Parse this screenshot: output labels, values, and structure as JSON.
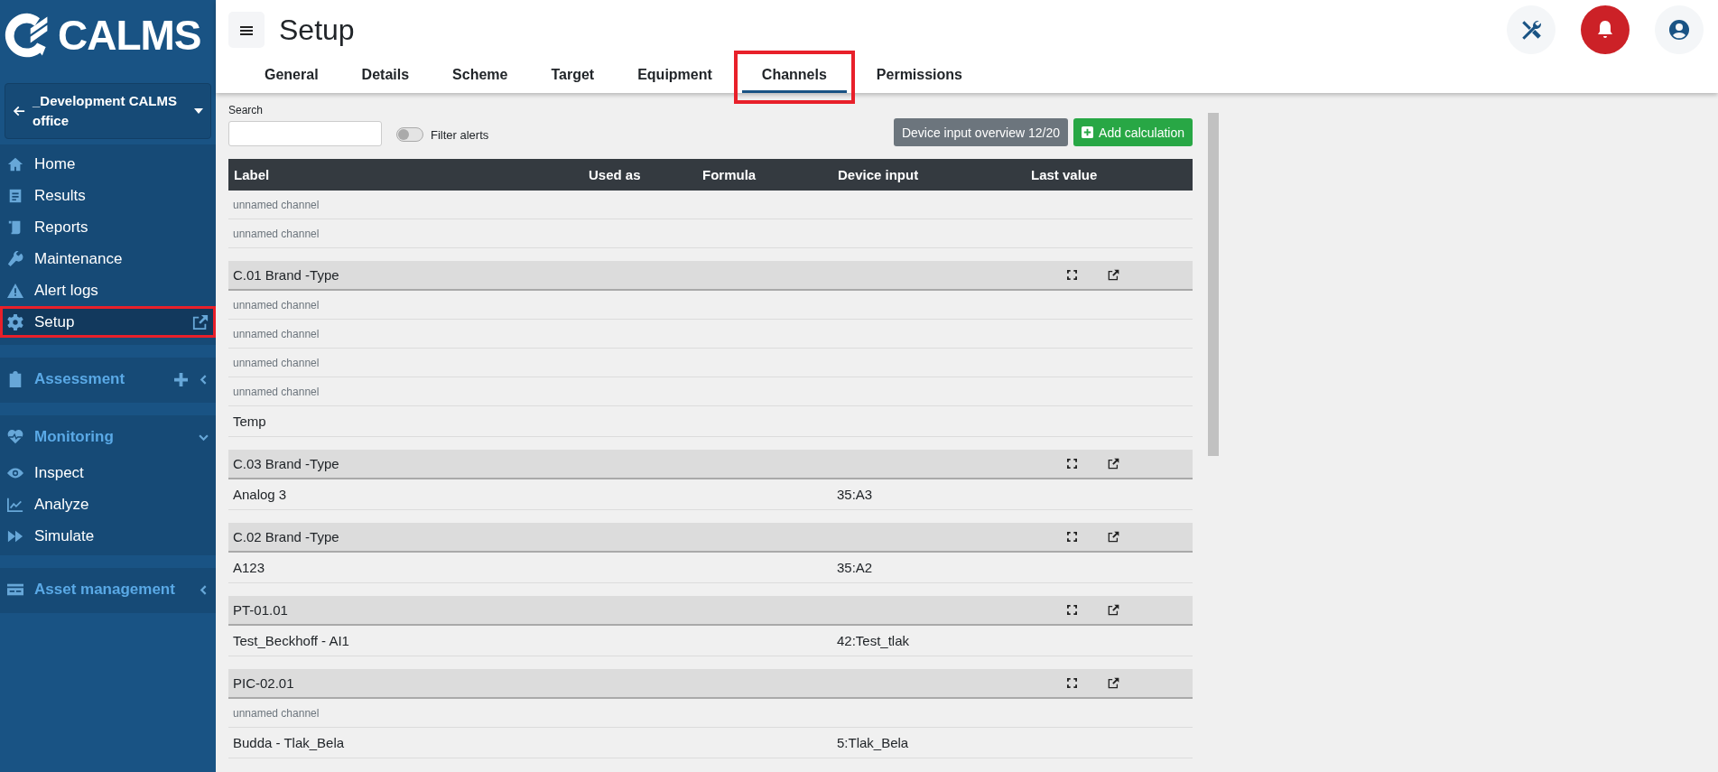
{
  "logo": {
    "text": "CALMS"
  },
  "project": {
    "name": "_Development CALMS office"
  },
  "sidebar": {
    "items": [
      {
        "label": "Home",
        "selected": false,
        "highlighted": false
      },
      {
        "label": "Results",
        "selected": false,
        "highlighted": false
      },
      {
        "label": "Reports",
        "selected": false,
        "highlighted": false
      },
      {
        "label": "Maintenance",
        "selected": false,
        "highlighted": false
      },
      {
        "label": "Alert logs",
        "selected": false,
        "highlighted": false
      },
      {
        "label": "Setup",
        "selected": true,
        "highlighted": true,
        "external": true
      }
    ],
    "sections": [
      {
        "label": "Assessment",
        "expanded": false,
        "addable": true
      },
      {
        "label": "Monitoring",
        "expanded": true,
        "items": [
          {
            "label": "Inspect"
          },
          {
            "label": "Analyze"
          },
          {
            "label": "Simulate"
          }
        ]
      },
      {
        "label": "Asset management",
        "expanded": false
      }
    ]
  },
  "header": {
    "title": "Setup"
  },
  "tabs": [
    {
      "label": "General",
      "selected": false,
      "highlighted": false
    },
    {
      "label": "Details",
      "selected": false,
      "highlighted": false
    },
    {
      "label": "Scheme",
      "selected": false,
      "highlighted": false
    },
    {
      "label": "Target",
      "selected": false,
      "highlighted": false
    },
    {
      "label": "Equipment",
      "selected": false,
      "highlighted": false
    },
    {
      "label": "Channels",
      "selected": true,
      "highlighted": true
    },
    {
      "label": "Permissions",
      "selected": false,
      "highlighted": false
    }
  ],
  "toolbar": {
    "search_label": "Search",
    "filter_alerts": {
      "label": "Filter alerts",
      "on": false
    },
    "overview_button": "Device input overview 12/20",
    "add_button": "Add calculation"
  },
  "table": {
    "columns": [
      "Label",
      "Used as",
      "Formula",
      "Device input",
      "Last value"
    ],
    "groups": [
      {
        "rows": [
          {
            "kind": "unnamed",
            "label": "unnamed channel"
          },
          {
            "kind": "unnamed",
            "label": "unnamed channel"
          }
        ]
      },
      {
        "title": "C.01 Brand -Type",
        "rows": [
          {
            "kind": "unnamed",
            "label": "unnamed channel"
          },
          {
            "kind": "unnamed",
            "label": "unnamed channel"
          },
          {
            "kind": "unnamed",
            "label": "unnamed channel"
          },
          {
            "kind": "unnamed",
            "label": "unnamed channel"
          },
          {
            "kind": "named",
            "label": "Temp"
          }
        ]
      },
      {
        "title": "C.03 Brand -Type",
        "rows": [
          {
            "kind": "named",
            "label": "Analog 3",
            "device_input": "35:A3"
          }
        ]
      },
      {
        "title": "C.02 Brand -Type",
        "rows": [
          {
            "kind": "named",
            "label": "A123",
            "device_input": "35:A2"
          }
        ]
      },
      {
        "title": "PT-01.01",
        "rows": [
          {
            "kind": "named",
            "label": "Test_Beckhoff - AI1",
            "device_input": "42:Test_tlak"
          }
        ]
      },
      {
        "title": "PIC-02.01",
        "rows": [
          {
            "kind": "unnamed",
            "label": "unnamed channel"
          },
          {
            "kind": "named",
            "label": "Budda - Tlak_Bela",
            "device_input": "5:Tlak_Bela"
          }
        ]
      }
    ]
  }
}
